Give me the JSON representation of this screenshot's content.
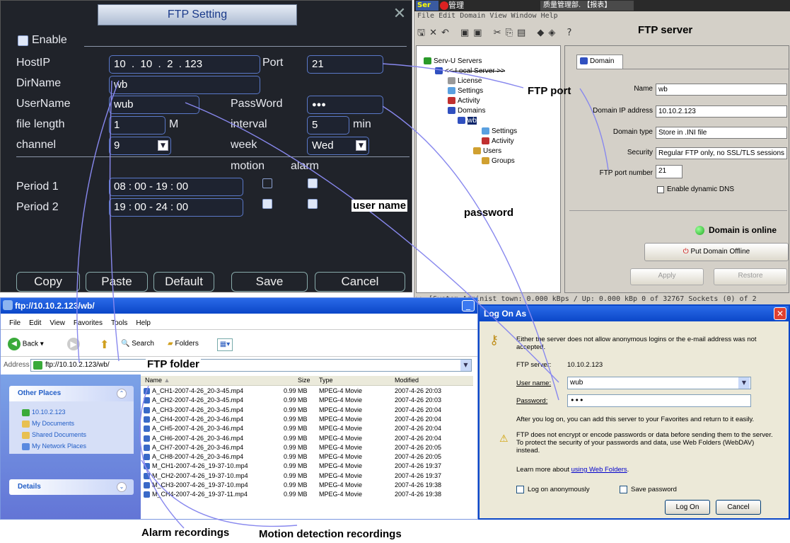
{
  "dvr": {
    "title": "FTP Setting",
    "enable": "Enable",
    "hostip_label": "HostIP",
    "ip": [
      "10",
      "10",
      "2",
      "123"
    ],
    "port_label": "Port",
    "port": "21",
    "dirname_label": "DirName",
    "dirname": "wb",
    "username_label": "UserName",
    "username": "wub",
    "password_label": "PassWord",
    "password": "●●●",
    "file_length_label": "file length",
    "file_length": "1",
    "file_length_unit": "M",
    "interval_label": "interval",
    "interval": "5",
    "interval_unit": "min",
    "channel_label": "channel",
    "channel": "9",
    "week_label": "week",
    "week": "Wed",
    "motion_label": "motion",
    "alarm_label": "alarm",
    "period1_label": "Period 1",
    "period1": "08 : 00       - 19 : 00",
    "period2_label": "Period 2",
    "period2": "19 : 00       - 24 : 00",
    "buttons": {
      "copy": "Copy",
      "paste": "Paste",
      "default": "Default",
      "save": "Save",
      "cancel": "Cancel"
    }
  },
  "servu": {
    "app_title": "Ser",
    "tab_cn": "管理",
    "tab2": "质量管理部. 【报表】",
    "menu": "File  Edit  Domain  View  Window  Help",
    "tree": {
      "root": "Serv-U Servers",
      "local": "<< Local Server >>",
      "license": "License",
      "settings": "Settings",
      "activity": "Activity",
      "domains": "Domains",
      "domain": "wb",
      "d_settings": "Settings",
      "d_activity": "Activity",
      "users": "Users",
      "groups": "Groups"
    },
    "domain_tab": "Domain",
    "form": {
      "name_label": "Name",
      "name": "wb",
      "ip_label": "Domain IP address",
      "ip": "10.10.2.123",
      "type_label": "Domain type",
      "type": "Store in .INI file",
      "security_label": "Security",
      "security": "Regular FTP only, no SSL/TLS sessions",
      "port_label": "FTP port number",
      "port": "21",
      "dns": "Enable dynamic DNS",
      "online": "Domain is online",
      "offline_btn": "Put Domain Offline",
      "apply": "Apply",
      "restore": "Restore"
    },
    "status": ">>  [System Administ town: 0.000 kBps / Up: 0.000 kBp 0 of 32767 Sockets  (0) of 2"
  },
  "explorer": {
    "title": "ftp://10.10.2.123/wb/",
    "menu": [
      "File",
      "Edit",
      "View",
      "Favorites",
      "Tools",
      "Help"
    ],
    "back": "Back",
    "search": "Search",
    "folders": "Folders",
    "address_label": "Address",
    "address": "ftp://10.10.2.123/wb/",
    "other_places": "Other Places",
    "places": [
      "10.10.2.123",
      "My Documents",
      "Shared Documents",
      "My Network Places"
    ],
    "details": "Details",
    "columns": {
      "name": "Name",
      "size": "Size",
      "type": "Type",
      "modified": "Modified"
    },
    "files": [
      {
        "name": "A_CH1-2007-4-26_20-3-45.mp4",
        "size": "0.99 MB",
        "type": "MPEG-4 Movie",
        "modified": "2007-4-26 20:03"
      },
      {
        "name": "A_CH2-2007-4-26_20-3-45.mp4",
        "size": "0.99 MB",
        "type": "MPEG-4 Movie",
        "modified": "2007-4-26 20:03"
      },
      {
        "name": "A_CH3-2007-4-26_20-3-45.mp4",
        "size": "0.99 MB",
        "type": "MPEG-4 Movie",
        "modified": "2007-4-26 20:04"
      },
      {
        "name": "A_CH4-2007-4-26_20-3-46.mp4",
        "size": "0.99 MB",
        "type": "MPEG-4 Movie",
        "modified": "2007-4-26 20:04"
      },
      {
        "name": "A_CH5-2007-4-26_20-3-46.mp4",
        "size": "0.99 MB",
        "type": "MPEG-4 Movie",
        "modified": "2007-4-26 20:04"
      },
      {
        "name": "A_CH6-2007-4-26_20-3-46.mp4",
        "size": "0.99 MB",
        "type": "MPEG-4 Movie",
        "modified": "2007-4-26 20:04"
      },
      {
        "name": "A_CH7-2007-4-26_20-3-46.mp4",
        "size": "0.99 MB",
        "type": "MPEG-4 Movie",
        "modified": "2007-4-26 20:05"
      },
      {
        "name": "A_CH8-2007-4-26_20-3-46.mp4",
        "size": "0.99 MB",
        "type": "MPEG-4 Movie",
        "modified": "2007-4-26 20:05"
      },
      {
        "name": "M_CH1-2007-4-26_19-37-10.mp4",
        "size": "0.99 MB",
        "type": "MPEG-4 Movie",
        "modified": "2007-4-26 19:37"
      },
      {
        "name": "M_CH2-2007-4-26_19-37-10.mp4",
        "size": "0.99 MB",
        "type": "MPEG-4 Movie",
        "modified": "2007-4-26 19:37"
      },
      {
        "name": "M_CH3-2007-4-26_19-37-10.mp4",
        "size": "0.99 MB",
        "type": "MPEG-4 Movie",
        "modified": "2007-4-26 19:38"
      },
      {
        "name": "M_CH4-2007-4-26_19-37-11.mp4",
        "size": "0.99 MB",
        "type": "MPEG-4 Movie",
        "modified": "2007-4-26 19:38"
      }
    ]
  },
  "logon": {
    "title": "Log On As",
    "intro": "Either the server does not allow anonymous logins or the e-mail address was not accepted.",
    "server_label": "FTP server:",
    "server": "10.10.2.123",
    "user_label": "User name:",
    "user": "wub",
    "pass_label": "Password:",
    "pass": "•••",
    "after": "After you log on, you can add this server to your Favorites and return to it easily.",
    "warning": "FTP does not encrypt or encode passwords or data before sending them to the server.  To protect the security of your passwords and data, use Web Folders (WebDAV) instead.",
    "learn_prefix": "Learn more about ",
    "learn_link": "using Web Folders",
    "learn_suffix": ".",
    "anon": "Log on anonymously",
    "save_pw": "Save password",
    "logon_btn": "Log On",
    "cancel_btn": "Cancel"
  },
  "annotations": {
    "ftp_server": "FTP server",
    "ftp_port": "FTP port",
    "user_name": "user name",
    "password": "password",
    "ftp_folder": "FTP folder",
    "alarm_rec": "Alarm recordings",
    "motion_rec": "Motion detection recordings"
  }
}
